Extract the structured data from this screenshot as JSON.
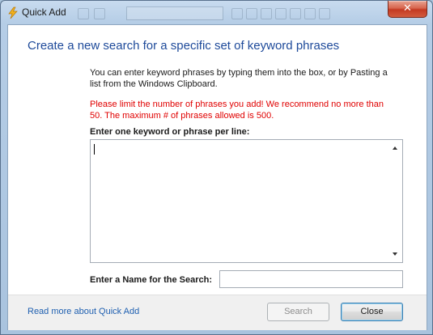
{
  "window": {
    "title": "Quick Add",
    "close_glyph": "✕"
  },
  "dialog": {
    "heading": "Create a new search for a specific set of keyword phrases",
    "intro_text": "You can enter keyword phrases by typing them into the box, or by Pasting a list from the Windows Clipboard.",
    "warning_text": "Please limit the number of phrases you add! We recommend no more than 50. The maximum # of phrases allowed is 500.",
    "keywords_label": "Enter one keyword or phrase per line:",
    "keywords_value": "",
    "name_label": "Enter a Name for the Search:",
    "name_value": ""
  },
  "footer": {
    "read_more_link": "Read more about Quick Add",
    "search_button": "Search",
    "close_button": "Close"
  },
  "colors": {
    "heading": "#1e4a9a",
    "warning": "#e00000",
    "link": "#1e5fb0",
    "close_button_bg": "#c43a22"
  },
  "icons": {
    "app_icon": "lightning-bolt-icon"
  }
}
